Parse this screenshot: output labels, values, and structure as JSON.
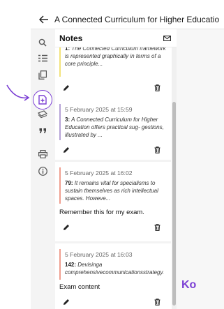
{
  "window": {
    "title": "A Connected Curriculum for Higher Educatio"
  },
  "rail": {
    "icons": [
      "search-icon",
      "toc-icon",
      "copy-icon",
      "add-note-icon",
      "highlights-icon",
      "quote-icon",
      "print-icon",
      "info-icon"
    ],
    "active": "add-note-icon"
  },
  "panel": {
    "title": "Notes"
  },
  "notes": [
    {
      "date": "",
      "number": "1:",
      "excerpt": "The Connected Curriculum framework is represented graphically in terms of a core principle...",
      "note": "",
      "color": "#f2e27a"
    },
    {
      "date": "5 February 2025 at 15:59",
      "number": "3:",
      "excerpt": "A Connected Curriculum for Higher Education offers practical sug- gestions, illustrated by ...",
      "note": "",
      "color": "#b5a2d6"
    },
    {
      "date": "5 February 2025 at 16:02",
      "number": "79:",
      "excerpt": "It remains vital for specialisms to sustain themselves as rich intellectual spaces. Howeve...",
      "note": "Remember this for my exam.",
      "color": "#ef9e8f"
    },
    {
      "date": "5 February 2025 at 16:03",
      "number": "142:",
      "excerpt": "Devisinga comprehensivecommunicationsstrategy.",
      "note": "Exam content",
      "color": "#ef9e8f"
    }
  ],
  "brand": {
    "accent": "#7b3fd4",
    "logo_text": "Ko"
  }
}
